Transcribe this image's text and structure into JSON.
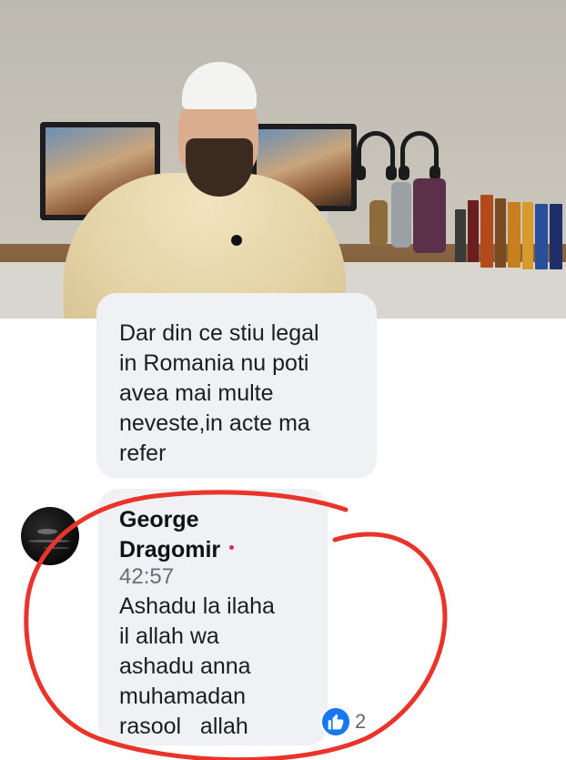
{
  "video": {
    "description_icon": "video-frame"
  },
  "comments": [
    {
      "text_lines": "Dar din ce stiu legal\nin Romania nu poti\navea mai multe\nneveste,in acte ma\nrefer"
    },
    {
      "author": "George\nDragomir",
      "timestamp": "42:57",
      "text_lines": "Ashadu la ilaha\nil allah wa\nashadu anna\nmuhamadan\nrasool   allah",
      "reactions": {
        "icon": "thumbs-up-icon",
        "count": "2"
      }
    }
  ],
  "colors": {
    "bubble": "#f0f1f5",
    "like_blue": "#1877f2",
    "annotation_red": "#e8342b"
  }
}
